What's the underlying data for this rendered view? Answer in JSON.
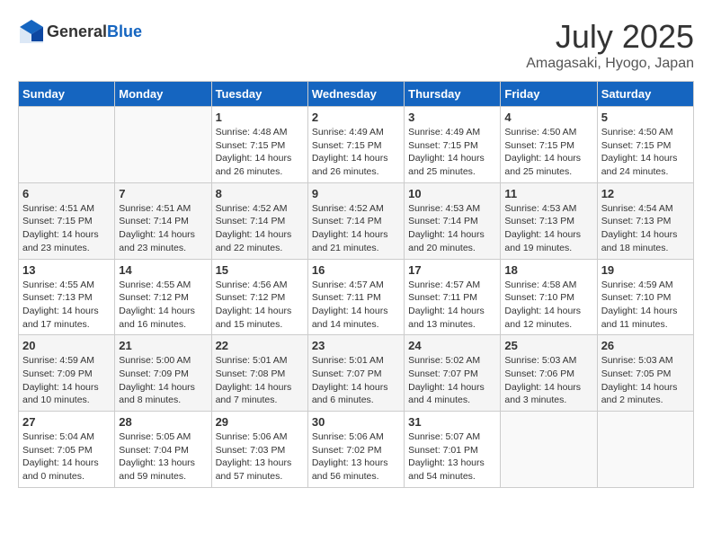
{
  "header": {
    "logo_general": "General",
    "logo_blue": "Blue",
    "month_year": "July 2025",
    "location": "Amagasaki, Hyogo, Japan"
  },
  "days_of_week": [
    "Sunday",
    "Monday",
    "Tuesday",
    "Wednesday",
    "Thursday",
    "Friday",
    "Saturday"
  ],
  "weeks": [
    [
      {
        "day": "",
        "info": ""
      },
      {
        "day": "",
        "info": ""
      },
      {
        "day": "1",
        "info": "Sunrise: 4:48 AM\nSunset: 7:15 PM\nDaylight: 14 hours\nand 26 minutes."
      },
      {
        "day": "2",
        "info": "Sunrise: 4:49 AM\nSunset: 7:15 PM\nDaylight: 14 hours\nand 26 minutes."
      },
      {
        "day": "3",
        "info": "Sunrise: 4:49 AM\nSunset: 7:15 PM\nDaylight: 14 hours\nand 25 minutes."
      },
      {
        "day": "4",
        "info": "Sunrise: 4:50 AM\nSunset: 7:15 PM\nDaylight: 14 hours\nand 25 minutes."
      },
      {
        "day": "5",
        "info": "Sunrise: 4:50 AM\nSunset: 7:15 PM\nDaylight: 14 hours\nand 24 minutes."
      }
    ],
    [
      {
        "day": "6",
        "info": "Sunrise: 4:51 AM\nSunset: 7:15 PM\nDaylight: 14 hours\nand 23 minutes."
      },
      {
        "day": "7",
        "info": "Sunrise: 4:51 AM\nSunset: 7:14 PM\nDaylight: 14 hours\nand 23 minutes."
      },
      {
        "day": "8",
        "info": "Sunrise: 4:52 AM\nSunset: 7:14 PM\nDaylight: 14 hours\nand 22 minutes."
      },
      {
        "day": "9",
        "info": "Sunrise: 4:52 AM\nSunset: 7:14 PM\nDaylight: 14 hours\nand 21 minutes."
      },
      {
        "day": "10",
        "info": "Sunrise: 4:53 AM\nSunset: 7:14 PM\nDaylight: 14 hours\nand 20 minutes."
      },
      {
        "day": "11",
        "info": "Sunrise: 4:53 AM\nSunset: 7:13 PM\nDaylight: 14 hours\nand 19 minutes."
      },
      {
        "day": "12",
        "info": "Sunrise: 4:54 AM\nSunset: 7:13 PM\nDaylight: 14 hours\nand 18 minutes."
      }
    ],
    [
      {
        "day": "13",
        "info": "Sunrise: 4:55 AM\nSunset: 7:13 PM\nDaylight: 14 hours\nand 17 minutes."
      },
      {
        "day": "14",
        "info": "Sunrise: 4:55 AM\nSunset: 7:12 PM\nDaylight: 14 hours\nand 16 minutes."
      },
      {
        "day": "15",
        "info": "Sunrise: 4:56 AM\nSunset: 7:12 PM\nDaylight: 14 hours\nand 15 minutes."
      },
      {
        "day": "16",
        "info": "Sunrise: 4:57 AM\nSunset: 7:11 PM\nDaylight: 14 hours\nand 14 minutes."
      },
      {
        "day": "17",
        "info": "Sunrise: 4:57 AM\nSunset: 7:11 PM\nDaylight: 14 hours\nand 13 minutes."
      },
      {
        "day": "18",
        "info": "Sunrise: 4:58 AM\nSunset: 7:10 PM\nDaylight: 14 hours\nand 12 minutes."
      },
      {
        "day": "19",
        "info": "Sunrise: 4:59 AM\nSunset: 7:10 PM\nDaylight: 14 hours\nand 11 minutes."
      }
    ],
    [
      {
        "day": "20",
        "info": "Sunrise: 4:59 AM\nSunset: 7:09 PM\nDaylight: 14 hours\nand 10 minutes."
      },
      {
        "day": "21",
        "info": "Sunrise: 5:00 AM\nSunset: 7:09 PM\nDaylight: 14 hours\nand 8 minutes."
      },
      {
        "day": "22",
        "info": "Sunrise: 5:01 AM\nSunset: 7:08 PM\nDaylight: 14 hours\nand 7 minutes."
      },
      {
        "day": "23",
        "info": "Sunrise: 5:01 AM\nSunset: 7:07 PM\nDaylight: 14 hours\nand 6 minutes."
      },
      {
        "day": "24",
        "info": "Sunrise: 5:02 AM\nSunset: 7:07 PM\nDaylight: 14 hours\nand 4 minutes."
      },
      {
        "day": "25",
        "info": "Sunrise: 5:03 AM\nSunset: 7:06 PM\nDaylight: 14 hours\nand 3 minutes."
      },
      {
        "day": "26",
        "info": "Sunrise: 5:03 AM\nSunset: 7:05 PM\nDaylight: 14 hours\nand 2 minutes."
      }
    ],
    [
      {
        "day": "27",
        "info": "Sunrise: 5:04 AM\nSunset: 7:05 PM\nDaylight: 14 hours\nand 0 minutes."
      },
      {
        "day": "28",
        "info": "Sunrise: 5:05 AM\nSunset: 7:04 PM\nDaylight: 13 hours\nand 59 minutes."
      },
      {
        "day": "29",
        "info": "Sunrise: 5:06 AM\nSunset: 7:03 PM\nDaylight: 13 hours\nand 57 minutes."
      },
      {
        "day": "30",
        "info": "Sunrise: 5:06 AM\nSunset: 7:02 PM\nDaylight: 13 hours\nand 56 minutes."
      },
      {
        "day": "31",
        "info": "Sunrise: 5:07 AM\nSunset: 7:01 PM\nDaylight: 13 hours\nand 54 minutes."
      },
      {
        "day": "",
        "info": ""
      },
      {
        "day": "",
        "info": ""
      }
    ]
  ]
}
